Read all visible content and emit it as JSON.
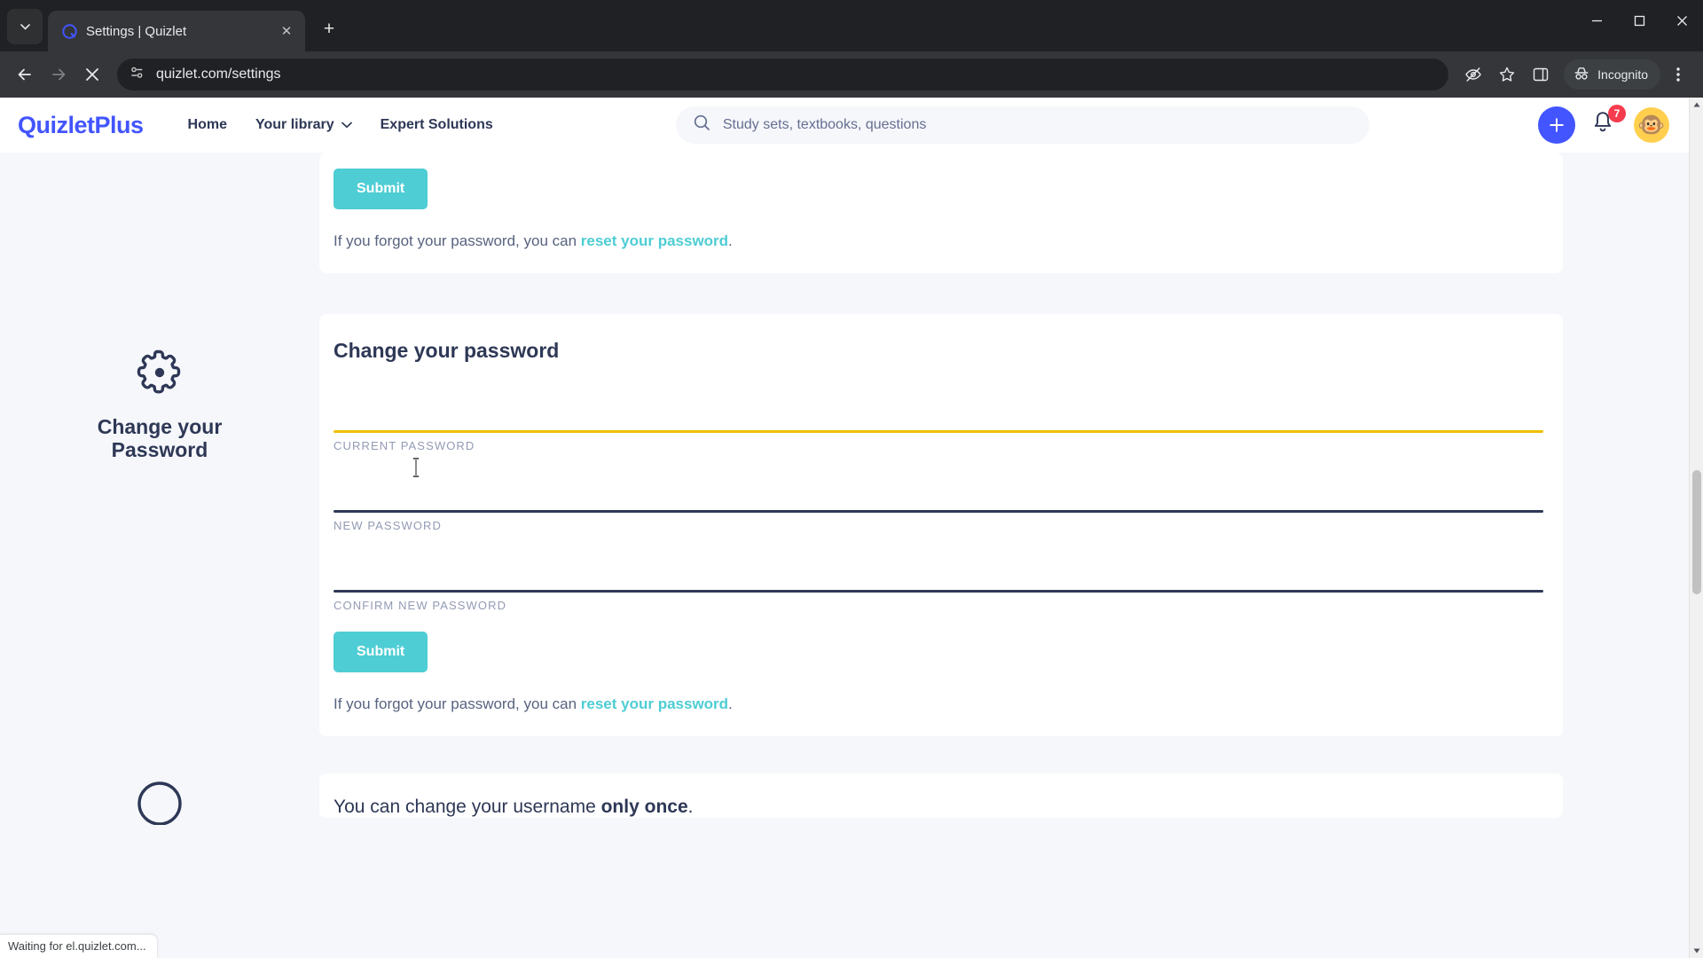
{
  "browser": {
    "tab": {
      "title": "Settings | Quizlet",
      "favicon_name": "quizlet-favicon",
      "close_label": "✕"
    },
    "new_tab_label": "+",
    "tab_search_label": "⌄",
    "window_controls": {
      "minimize": "—",
      "maximize": "☐",
      "close": "✕"
    },
    "toolbar": {
      "back_label": "←",
      "forward_label": "→",
      "stop_label": "✕",
      "site_info_name": "page-info-icon",
      "url": "quizlet.com/settings",
      "tracking_protection_icon": "eye-slash-icon",
      "bookmark_icon": "star-icon",
      "side_panel_icon": "side-panel-icon",
      "incognito_label": "Incognito",
      "menu_label": "⋮"
    },
    "status_text": "Waiting for el.quizlet.com..."
  },
  "site": {
    "logo": "Quizlet",
    "logo_suffix": "Plus",
    "nav": [
      {
        "label": "Home",
        "has_chevron": false
      },
      {
        "label": "Your library",
        "has_chevron": true
      },
      {
        "label": "Expert Solutions",
        "has_chevron": false
      }
    ],
    "search": {
      "placeholder": "Study sets, textbooks, questions",
      "value": ""
    },
    "create_button_label": "+",
    "notifications_count": "7",
    "avatar_emoji": "🐵"
  },
  "sections": [
    {
      "aside_icon": "",
      "aside_title": "",
      "card_title": "",
      "fields": [],
      "submit_label": "Submit",
      "helper_prefix": "If you forgot your password, you can ",
      "helper_link": "reset your password",
      "helper_suffix": "."
    },
    {
      "aside_icon": "gear-icon",
      "aside_title_line1": "Change your",
      "aside_title_line2": "Password",
      "card_title": "Change your password",
      "fields": [
        {
          "label": "CURRENT PASSWORD",
          "value": "",
          "focused": true,
          "underline_color": "#edbf02"
        },
        {
          "label": "NEW PASSWORD",
          "value": "",
          "focused": false,
          "underline_color": "#2e3856"
        },
        {
          "label": "CONFIRM NEW PASSWORD",
          "value": "",
          "focused": false,
          "underline_color": "#2e3856"
        }
      ],
      "submit_label": "Submit",
      "helper_prefix": "If you forgot your password, you can ",
      "helper_link": "reset your password",
      "helper_suffix": "."
    }
  ],
  "truncated_section": {
    "text_prefix": "You can change your username ",
    "text_bold": "only once",
    "text_suffix": "."
  },
  "colors": {
    "brand_blue": "#4255ff",
    "teal_accent": "#4ecdd4",
    "navy_text": "#2e3856",
    "focus_yellow": "#edbf02",
    "badge_red": "#f53b4e",
    "page_bg": "#f6f7fb"
  },
  "scrollbar": {
    "up_arrow": "▲",
    "down_arrow": "▼"
  }
}
